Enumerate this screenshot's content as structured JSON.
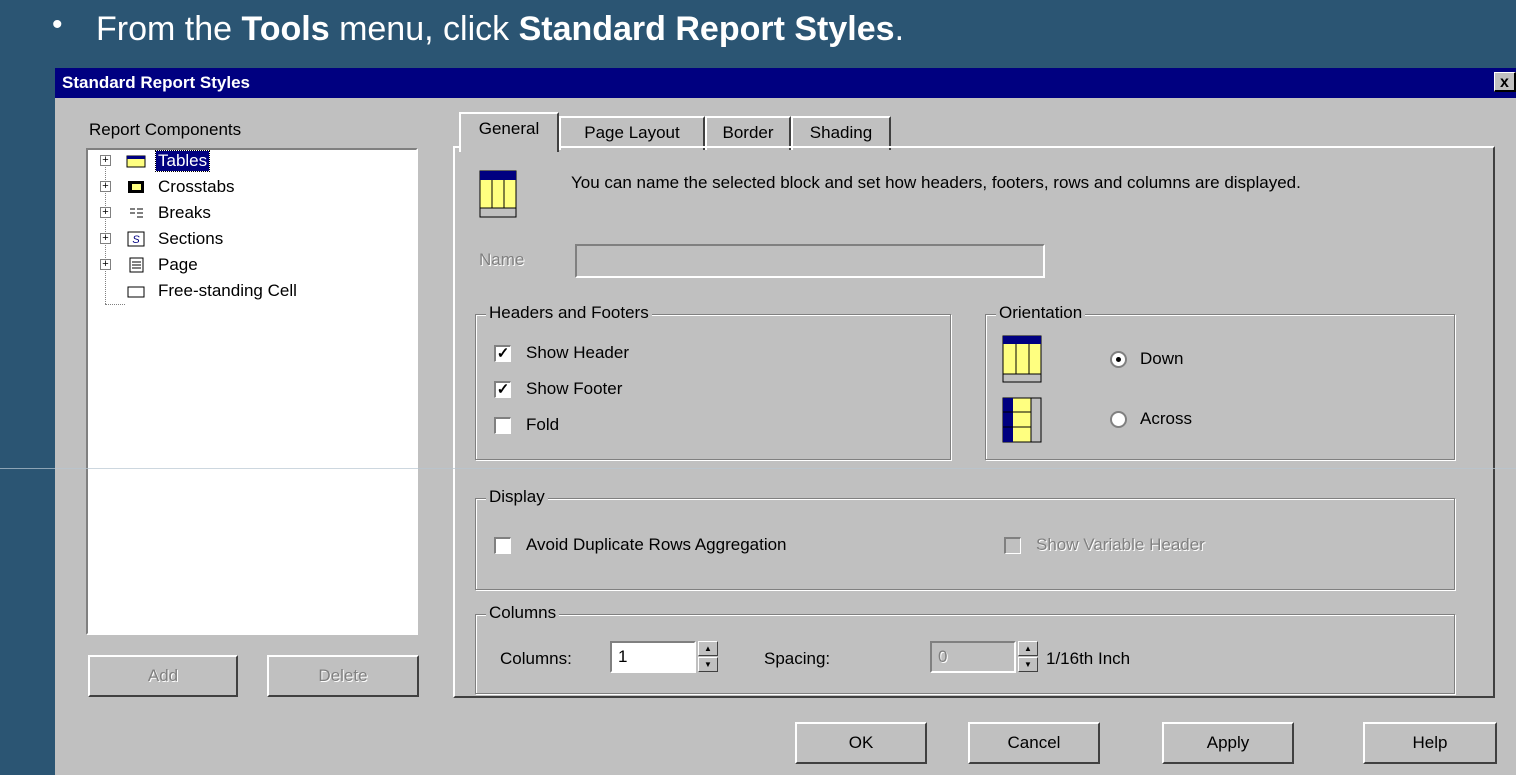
{
  "instruction": {
    "bullet": "•",
    "prefix": "From the ",
    "menu": "Tools",
    "middle": " menu, click ",
    "command": "Standard Report Styles",
    "suffix": "."
  },
  "dialog": {
    "title": "Standard Report Styles",
    "close_label": "x"
  },
  "components": {
    "label": "Report Components",
    "items": [
      {
        "label": "Tables",
        "icon": "table-icon"
      },
      {
        "label": "Crosstabs",
        "icon": "crosstab-icon"
      },
      {
        "label": "Breaks",
        "icon": "breaks-icon"
      },
      {
        "label": "Sections",
        "icon": "section-icon"
      },
      {
        "label": "Page",
        "icon": "page-icon"
      },
      {
        "label": "Free-standing Cell",
        "icon": "cell-icon"
      }
    ],
    "add_label": "Add",
    "delete_label": "Delete"
  },
  "tabs": [
    "General",
    "Page Layout",
    "Border",
    "Shading"
  ],
  "general": {
    "description": "You can name the selected block and set how headers, footers, rows and columns are displayed.",
    "name_label": "Name",
    "name_value": "",
    "headers_footers": {
      "legend": "Headers and Footers",
      "show_header": "Show Header",
      "show_footer": "Show Footer",
      "fold": "Fold",
      "show_header_checked": true,
      "show_footer_checked": true,
      "fold_checked": false
    },
    "orientation": {
      "legend": "Orientation",
      "down": "Down",
      "across": "Across",
      "selected": "Down"
    },
    "display": {
      "legend": "Display",
      "avoid_duplicate": "Avoid Duplicate Rows Aggregation",
      "show_variable_header": "Show Variable Header"
    },
    "columns": {
      "legend": "Columns",
      "columns_label": "Columns:",
      "columns_value": "1",
      "spacing_label": "Spacing:",
      "spacing_value": "0",
      "unit": "1/16th Inch"
    }
  },
  "buttons": {
    "ok": "OK",
    "cancel": "Cancel",
    "apply": "Apply",
    "help": "Help"
  },
  "colors": {
    "background": "#2b5573",
    "titlebar": "#000080",
    "dialog": "#c0c0c0"
  }
}
